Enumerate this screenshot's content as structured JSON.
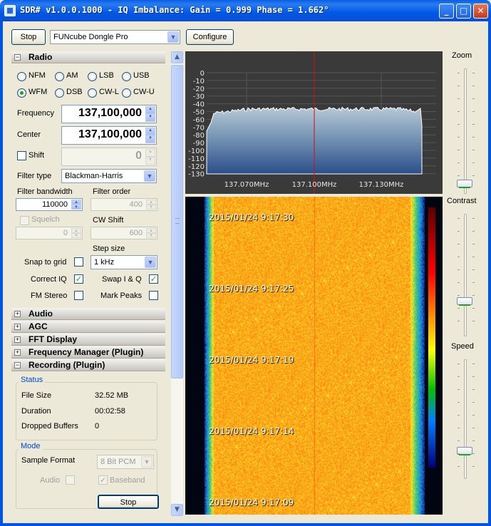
{
  "window": {
    "title": "SDR# v1.0.0.1000 - IQ Imbalance: Gain = 0.999 Phase = 1.662°",
    "minimize": "_",
    "maximize": "□",
    "close": "✕"
  },
  "toolbar": {
    "stop_label": "Stop",
    "device": "FUNcube Dongle Pro",
    "configure_label": "Configure"
  },
  "radio": {
    "section_label": "Radio",
    "modes": [
      {
        "label": "NFM",
        "selected": false
      },
      {
        "label": "AM",
        "selected": false
      },
      {
        "label": "LSB",
        "selected": false
      },
      {
        "label": "USB",
        "selected": false
      },
      {
        "label": "WFM",
        "selected": true
      },
      {
        "label": "DSB",
        "selected": false
      },
      {
        "label": "CW-L",
        "selected": false
      },
      {
        "label": "CW-U",
        "selected": false
      }
    ],
    "frequency_label": "Frequency",
    "frequency": "137,100,000",
    "center_label": "Center",
    "center": "137,100,000",
    "shift_label": "Shift",
    "shift": "0",
    "filter_type_label": "Filter type",
    "filter_type": "Blackman-Harris",
    "filter_bandwidth_label": "Filter bandwidth",
    "filter_bandwidth": "110000",
    "filter_order_label": "Filter order",
    "filter_order": "400",
    "squelch_label": "Squelch",
    "squelch": "0",
    "cw_shift_label": "CW Shift",
    "cw_shift": "600",
    "step_size_label": "Step size",
    "step_size": "1 kHz",
    "snap_to_grid_label": "Snap to grid",
    "correct_iq_label": "Correct IQ",
    "swap_iq_label": "Swap I & Q",
    "fm_stereo_label": "FM Stereo",
    "mark_peaks_label": "Mark Peaks"
  },
  "sections": {
    "audio": "Audio",
    "agc": "AGC",
    "fft": "FFT Display",
    "freq_manager": "Frequency Manager (Plugin)",
    "recording": "Recording (Plugin)"
  },
  "recording": {
    "status_title": "Status",
    "file_size_label": "File Size",
    "file_size": "32.52 MB",
    "duration_label": "Duration",
    "duration": "00:02:58",
    "dropped_label": "Dropped Buffers",
    "dropped": "0",
    "mode_title": "Mode",
    "sample_format_label": "Sample Format",
    "sample_format": "8 Bit PCM",
    "audio_label": "Audio",
    "baseband_label": "Baseband",
    "stop_label": "Stop"
  },
  "spectrum": {
    "db_labels": [
      "0",
      "-10",
      "-20",
      "-30",
      "-40",
      "-50",
      "-60",
      "-70",
      "-80",
      "-90",
      "-100",
      "-110",
      "-120",
      "-130"
    ],
    "freq_labels": [
      "137.070MHz",
      "137.100MHz",
      "137.130MHz"
    ]
  },
  "waterfall": {
    "timestamps": [
      "2015/01/24 9:17:30",
      "2015/01/24 9:17:25",
      "2015/01/24 9:17:19",
      "2015/01/24 9:17:14",
      "2015/01/24 9:17:09"
    ]
  },
  "sliders": {
    "zoom_label": "Zoom",
    "contrast_label": "Contrast",
    "speed_label": "Speed"
  },
  "colors": {
    "accent": "#0054e3",
    "waterfall_hot": "#ff6a00",
    "waterfall_cold": "#0b2d7a",
    "marker": "#d01010"
  }
}
